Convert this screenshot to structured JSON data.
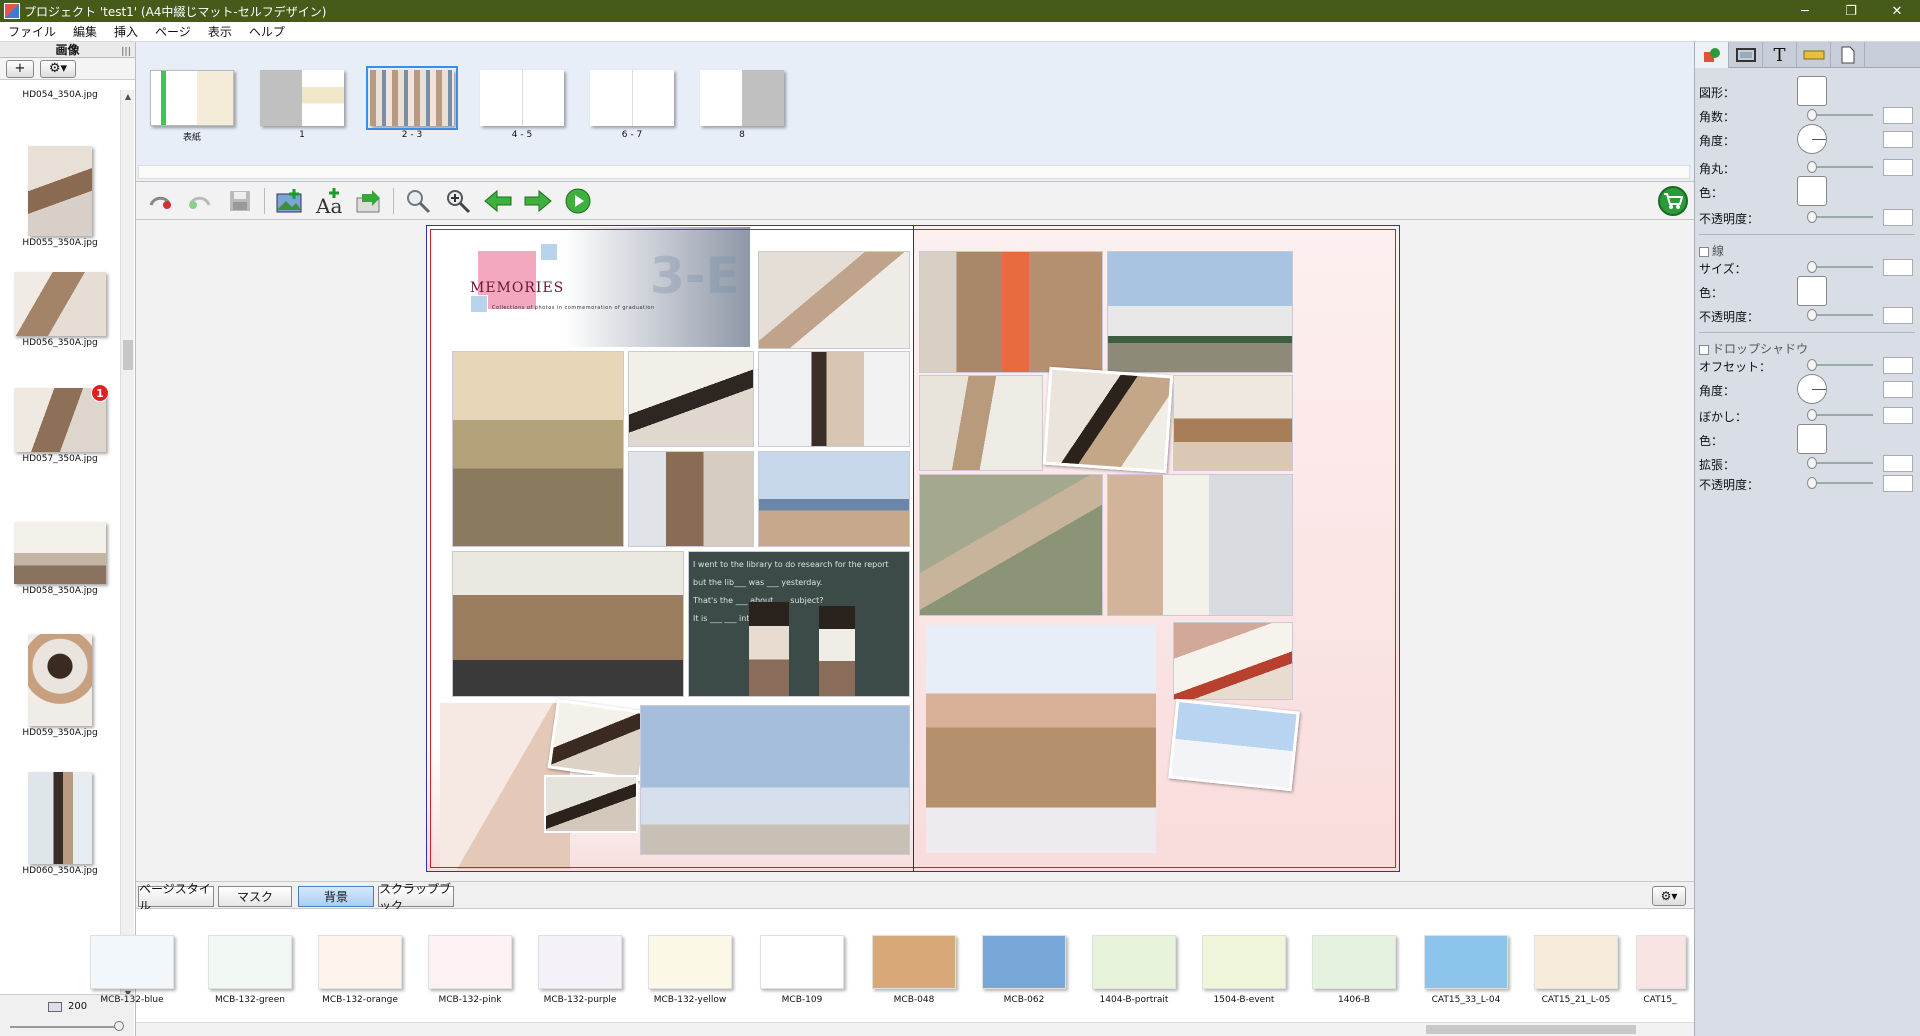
{
  "window": {
    "title": "プロジェクト 'test1' (A4中綴じマット-セルフデザイン)",
    "minimize": "─",
    "restore": "❐",
    "close": "✕"
  },
  "menu": [
    "ファイル",
    "編集",
    "挿入",
    "ページ",
    "表示",
    "ヘルプ"
  ],
  "left_panel": {
    "title": "画像",
    "add_button": "+",
    "settings_button": "⚙▾",
    "images": [
      {
        "name": "HD054_350A.jpg"
      },
      {
        "name": "HD055_350A.jpg"
      },
      {
        "name": "HD056_350A.jpg"
      },
      {
        "name": "HD057_350A.jpg",
        "badge": "1"
      },
      {
        "name": "HD058_350A.jpg"
      },
      {
        "name": "HD059_350A.jpg"
      },
      {
        "name": "HD060_350A.jpg"
      }
    ],
    "zoom_value": "200"
  },
  "pages": [
    {
      "label": "表紙"
    },
    {
      "label": "1"
    },
    {
      "label": "2 - 3",
      "selected": true
    },
    {
      "label": "4 - 5"
    },
    {
      "label": "6 - 7"
    },
    {
      "label": "8"
    }
  ],
  "toolbar": {
    "undo": "undo-icon",
    "redo": "redo-icon",
    "save": "save-icon",
    "add_image": "add-image-icon",
    "add_text": "add-text-icon",
    "export": "export-icon",
    "zoom_out": "zoom-out-icon",
    "zoom_in": "zoom-in-icon",
    "prev": "arrow-left-icon",
    "next": "arrow-right-icon",
    "play": "play-icon",
    "cart": "cart-icon"
  },
  "spread": {
    "memories_title": "MEMORIES",
    "memories_subtitle": "Collections of photos in commemoration of graduation",
    "sign_text": "3-E",
    "chalk_lines": [
      "I went to the library to do research for the report",
      "but the lib___ was ___ yesterday.",
      "That's the ___ about ___ subject?",
      "It is ___ ___ interesting."
    ]
  },
  "bottom_tabs": [
    {
      "label": "ページスタイル"
    },
    {
      "label": "マスク"
    },
    {
      "label": "背景",
      "active": true
    },
    {
      "label": "スクラップブック"
    }
  ],
  "backgrounds": [
    {
      "name": "MCB-132-blue",
      "color": "#f2f7fb"
    },
    {
      "name": "MCB-132-green",
      "color": "#f1f7f2"
    },
    {
      "name": "MCB-132-orange",
      "color": "#fbf3ec"
    },
    {
      "name": "MCB-132-pink",
      "color": "#fcf1f3"
    },
    {
      "name": "MCB-132-purple",
      "color": "#f5f1f9"
    },
    {
      "name": "MCB-132-yellow",
      "color": "#fbf8e8"
    },
    {
      "name": "MCB-109",
      "color": "#ffffff"
    },
    {
      "name": "MCB-048",
      "color": "#d8a878"
    },
    {
      "name": "MCB-062",
      "color": "#78a8d8"
    },
    {
      "name": "1404-B-portrait",
      "color": "#e8f3dc"
    },
    {
      "name": "1504-B-event",
      "color": "#eef5d8"
    },
    {
      "name": "1406-B",
      "color": "#e6f2e0"
    },
    {
      "name": "CAT15_33_L-04",
      "color": "#8cc4ec"
    },
    {
      "name": "CAT15_21_L-05",
      "color": "#f7ecdc"
    },
    {
      "name": "CAT15_",
      "color": "#f9e4e4"
    }
  ],
  "right_panel": {
    "tabs": [
      "shape-icon",
      "frame-icon",
      "text-icon",
      "ruler-icon",
      "page-icon"
    ],
    "shape_label": "図形：",
    "corners_label": "角数：",
    "angle_label": "角度：",
    "round_label": "角丸：",
    "color_label": "色：",
    "opacity_label": "不透明度：",
    "line_label": "線",
    "size_label": "サイズ：",
    "line_color_label": "色：",
    "line_opacity_label": "不透明度：",
    "shadow_label": "ドロップシャドウ",
    "offset_label": "オフセット：",
    "shadow_angle_label": "角度：",
    "blur_label": "ぼかし：",
    "shadow_color_label": "色：",
    "spread_label": "拡張：",
    "shadow_opacity_label": "不透明度："
  }
}
